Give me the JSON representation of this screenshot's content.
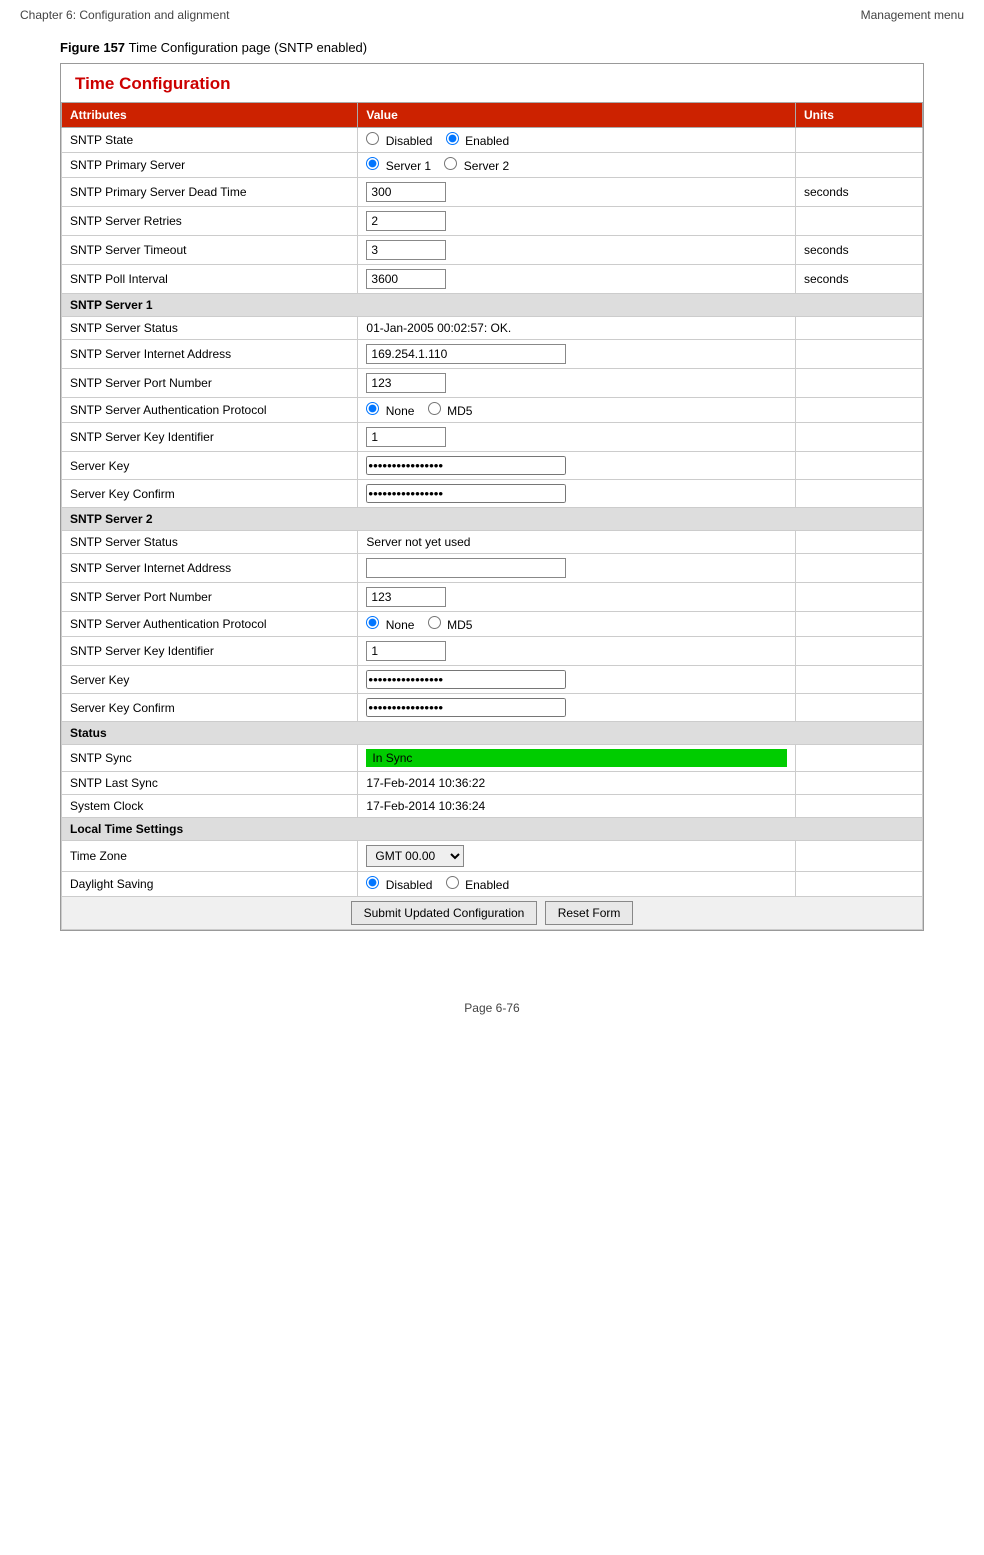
{
  "header": {
    "left": "Chapter 6:  Configuration and alignment",
    "right": "Management menu"
  },
  "figure": {
    "label": "Figure 157",
    "caption": "Time Configuration page (SNTP enabled)"
  },
  "form": {
    "title": "Time Configuration",
    "columns": {
      "attributes": "Attributes",
      "value": "Value",
      "units": "Units"
    },
    "rows": [
      {
        "attr": "SNTP State",
        "type": "radio2",
        "opt1": "Disabled",
        "opt2": "Enabled",
        "selected": "2",
        "units": ""
      },
      {
        "attr": "SNTP Primary Server",
        "type": "radio2",
        "opt1": "Server 1",
        "opt2": "Server 2",
        "selected": "1",
        "units": ""
      },
      {
        "attr": "SNTP Primary Server Dead Time",
        "type": "text",
        "value": "300",
        "width": "80",
        "units": "seconds"
      },
      {
        "attr": "SNTP Server Retries",
        "type": "text",
        "value": "2",
        "width": "80",
        "units": ""
      },
      {
        "attr": "SNTP Server Timeout",
        "type": "text",
        "value": "3",
        "width": "80",
        "units": "seconds"
      },
      {
        "attr": "SNTP Poll Interval",
        "type": "text",
        "value": "3600",
        "width": "80",
        "units": "seconds"
      }
    ],
    "server1_header": "SNTP Server 1",
    "server1_rows": [
      {
        "attr": "SNTP Server Status",
        "type": "static",
        "value": "01-Jan-2005 00:02:57: OK.",
        "units": ""
      },
      {
        "attr": "SNTP Server Internet Address",
        "type": "text",
        "value": "169.254.1.110",
        "width": "200",
        "units": ""
      },
      {
        "attr": "SNTP Server Port Number",
        "type": "text",
        "value": "123",
        "width": "80",
        "units": ""
      },
      {
        "attr": "SNTP Server Authentication Protocol",
        "type": "radio2",
        "opt1": "None",
        "opt2": "MD5",
        "selected": "1",
        "units": ""
      },
      {
        "attr": "SNTP Server Key Identifier",
        "type": "text",
        "value": "1",
        "width": "80",
        "units": ""
      },
      {
        "attr": "Server Key",
        "type": "password",
        "value": "................",
        "width": "200",
        "units": ""
      },
      {
        "attr": "Server Key Confirm",
        "type": "password",
        "value": "................",
        "width": "200",
        "units": ""
      }
    ],
    "server2_header": "SNTP Server 2",
    "server2_rows": [
      {
        "attr": "SNTP Server Status",
        "type": "static",
        "value": "Server not yet used",
        "units": ""
      },
      {
        "attr": "SNTP Server Internet Address",
        "type": "text",
        "value": "",
        "width": "200",
        "units": ""
      },
      {
        "attr": "SNTP Server Port Number",
        "type": "text",
        "value": "123",
        "width": "80",
        "units": ""
      },
      {
        "attr": "SNTP Server Authentication Protocol",
        "type": "radio2",
        "opt1": "None",
        "opt2": "MD5",
        "selected": "1",
        "units": ""
      },
      {
        "attr": "SNTP Server Key Identifier",
        "type": "text",
        "value": "1",
        "width": "80",
        "units": ""
      },
      {
        "attr": "Server Key",
        "type": "password",
        "value": "................",
        "width": "200",
        "units": ""
      },
      {
        "attr": "Server Key Confirm",
        "type": "password",
        "value": "................",
        "width": "200",
        "units": ""
      }
    ],
    "status_header": "Status",
    "status_rows": [
      {
        "attr": "SNTP Sync",
        "type": "status-green",
        "value": "In Sync",
        "units": ""
      },
      {
        "attr": "SNTP Last Sync",
        "type": "static",
        "value": "17-Feb-2014 10:36:22",
        "units": ""
      },
      {
        "attr": "System Clock",
        "type": "static",
        "value": "17-Feb-2014 10:36:24",
        "units": ""
      }
    ],
    "local_header": "Local Time Settings",
    "local_rows": [
      {
        "attr": "Time Zone",
        "type": "select",
        "value": "GMT 00.00",
        "units": ""
      },
      {
        "attr": "Daylight Saving",
        "type": "radio2",
        "opt1": "Disabled",
        "opt2": "Enabled",
        "selected": "1",
        "units": ""
      }
    ],
    "buttons": {
      "submit": "Submit Updated Configuration",
      "reset": "Reset Form"
    }
  },
  "footer": {
    "text": "Page 6-76"
  }
}
